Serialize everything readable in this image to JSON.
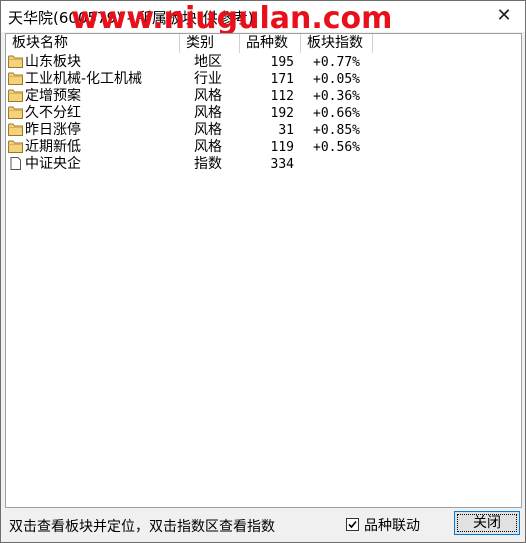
{
  "window": {
    "title": "天华院(600579) - 所属板块(供参考)",
    "watermark": "www.niugulan.com",
    "close_glyph": "✕"
  },
  "table": {
    "columns": [
      "板块名称",
      "类别",
      "品种数",
      "板块指数"
    ],
    "rows": [
      {
        "icon": "folder-icon",
        "name": "山东板块",
        "type": "地区",
        "count": "195",
        "index": "+0.77%"
      },
      {
        "icon": "folder-icon",
        "name": "工业机械-化工机械",
        "type": "行业",
        "count": "171",
        "index": "+0.05%"
      },
      {
        "icon": "folder-icon",
        "name": "定增预案",
        "type": "风格",
        "count": "112",
        "index": "+0.36%"
      },
      {
        "icon": "folder-icon",
        "name": "久不分红",
        "type": "风格",
        "count": "192",
        "index": "+0.66%"
      },
      {
        "icon": "folder-icon",
        "name": "昨日涨停",
        "type": "风格",
        "count": "31",
        "index": "+0.85%"
      },
      {
        "icon": "folder-icon",
        "name": "近期新低",
        "type": "风格",
        "count": "119",
        "index": "+0.56%"
      },
      {
        "icon": "document-icon",
        "name": "中证央企",
        "type": "指数",
        "count": "334",
        "index": ""
      }
    ]
  },
  "footer": {
    "hint": "双击查看板块并定位，双击指数区查看指数",
    "checkbox_label": "品种联动",
    "checkbox_checked": true,
    "close_button": "关闭"
  },
  "colors": {
    "watermark": "#e8101a",
    "folder": "#f3d27a",
    "button_focus": "#0078d7"
  }
}
